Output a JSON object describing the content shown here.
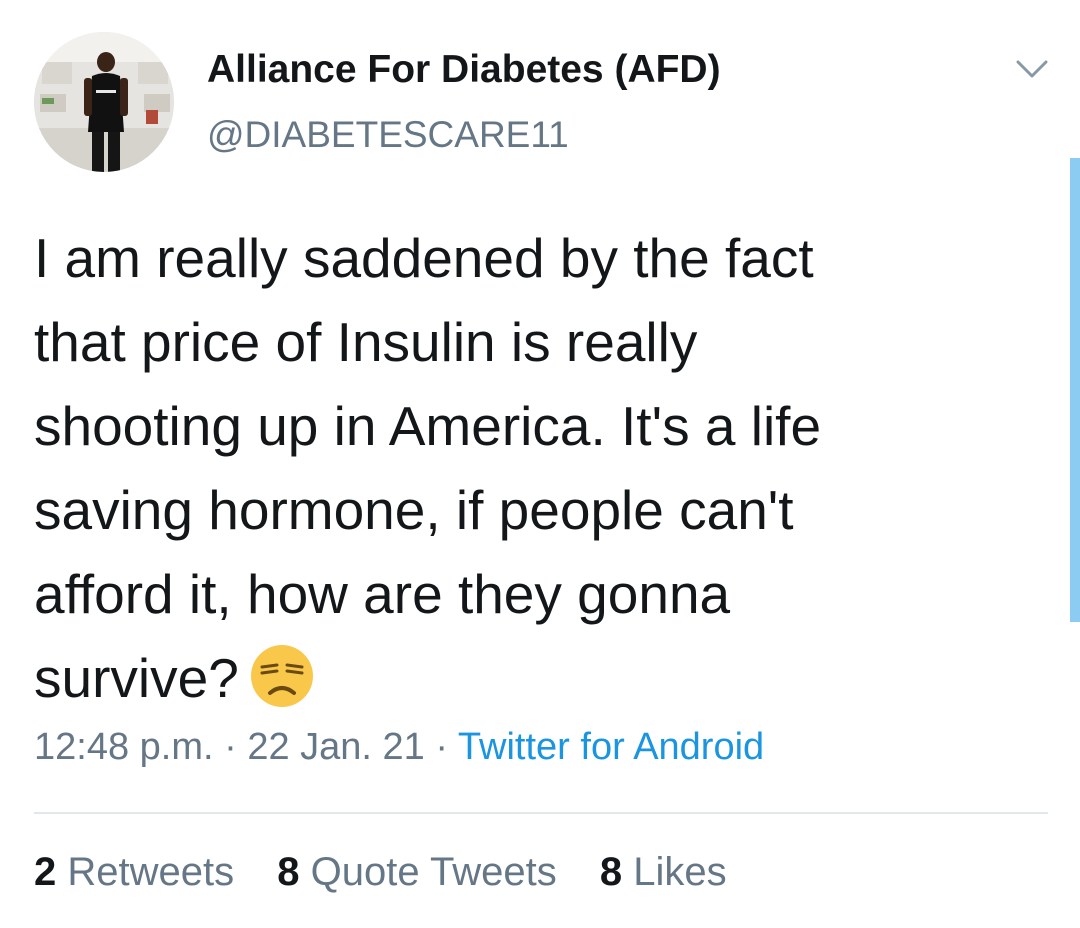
{
  "tweet": {
    "author": {
      "display_name": "Alliance For Diabetes (AFD)",
      "handle": "@DIABETESCARE11"
    },
    "text_lines": [
      "I am really saddened by the fact",
      "that price of Insulin is really",
      "shooting up in America. It's a life",
      "saving hormone, if people can't",
      "afford it, how are they gonna",
      "survive?"
    ],
    "emoji": "unamused-face-emoji",
    "time": "12:48 p.m.",
    "separator": " · ",
    "date": "22 Jan. 21",
    "source": "Twitter for Android"
  },
  "stats": {
    "retweets": {
      "count": "2",
      "label": "Retweets"
    },
    "quote_tweets": {
      "count": "8",
      "label": "Quote Tweets"
    },
    "likes": {
      "count": "8",
      "label": "Likes"
    }
  },
  "colors": {
    "text": "#14171a",
    "secondary": "#657786",
    "link": "#1b95e0",
    "divider": "#e1e8ed",
    "scroll_accent": "#8ccbf2"
  },
  "icons": {
    "caret": "chevron-down-icon"
  }
}
